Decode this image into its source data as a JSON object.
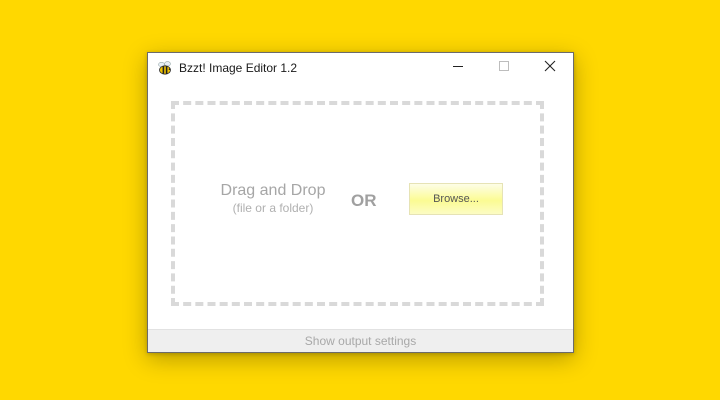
{
  "window": {
    "title": "Bzzt! Image Editor 1.2",
    "icon": "bee-icon"
  },
  "controls": {
    "minimize_icon": "minimize-icon",
    "maximize_icon": "maximize-icon",
    "close_icon": "close-icon"
  },
  "dropzone": {
    "title": "Drag and Drop",
    "subtitle": "(file or a folder)",
    "or_label": "OR",
    "browse_label": "Browse..."
  },
  "footer": {
    "output_settings_label": "Show output settings"
  },
  "colors": {
    "desktop_background": "#FFD800",
    "browse_highlight": "#FBFB93"
  }
}
